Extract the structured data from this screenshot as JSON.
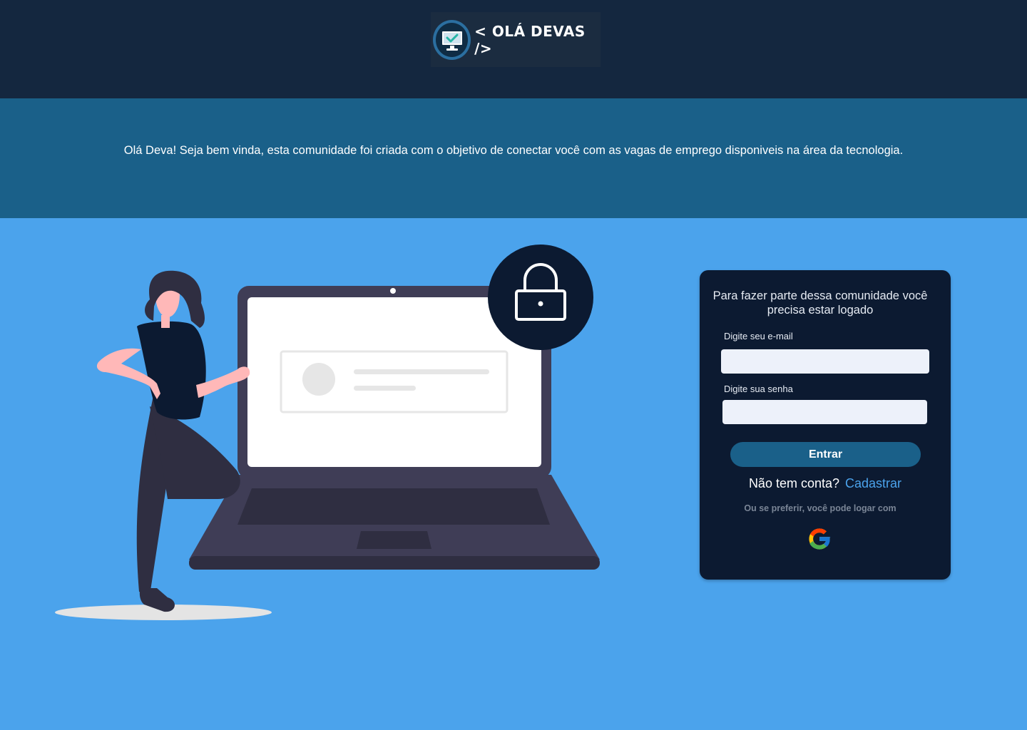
{
  "header": {
    "logo_text": "< OLÁ DEVAS />",
    "logo_icon": "monitor-check-icon",
    "colors": {
      "background": "#14273f"
    }
  },
  "welcome": {
    "message": "Olá Deva! Seja bem vinda, esta comunidade foi criada com o objetivo de conectar você com as vagas de emprego disponiveis na área da tecnologia.",
    "colors": {
      "background": "#1a6089"
    }
  },
  "login": {
    "title": "Para fazer parte dessa comunidade você precisa estar logado",
    "email_label": "Digite seu e-mail",
    "email_value": "",
    "password_label": "Digite sua senha",
    "password_value": "",
    "submit_label": "Entrar",
    "signup_prompt": "Não tem conta?",
    "signup_link": "Cadastrar",
    "alt_login_text": "Ou se preferir, você pode logar com",
    "alt_login_icon": "google-icon",
    "colors": {
      "card": "#0c1a31",
      "accent": "#4ba3ec",
      "button": "#1a6089"
    }
  },
  "illustration": {
    "icons": [
      "woman-figure",
      "laptop-icon",
      "lock-icon"
    ]
  },
  "page": {
    "colors": {
      "background": "#4ba3ec"
    }
  }
}
